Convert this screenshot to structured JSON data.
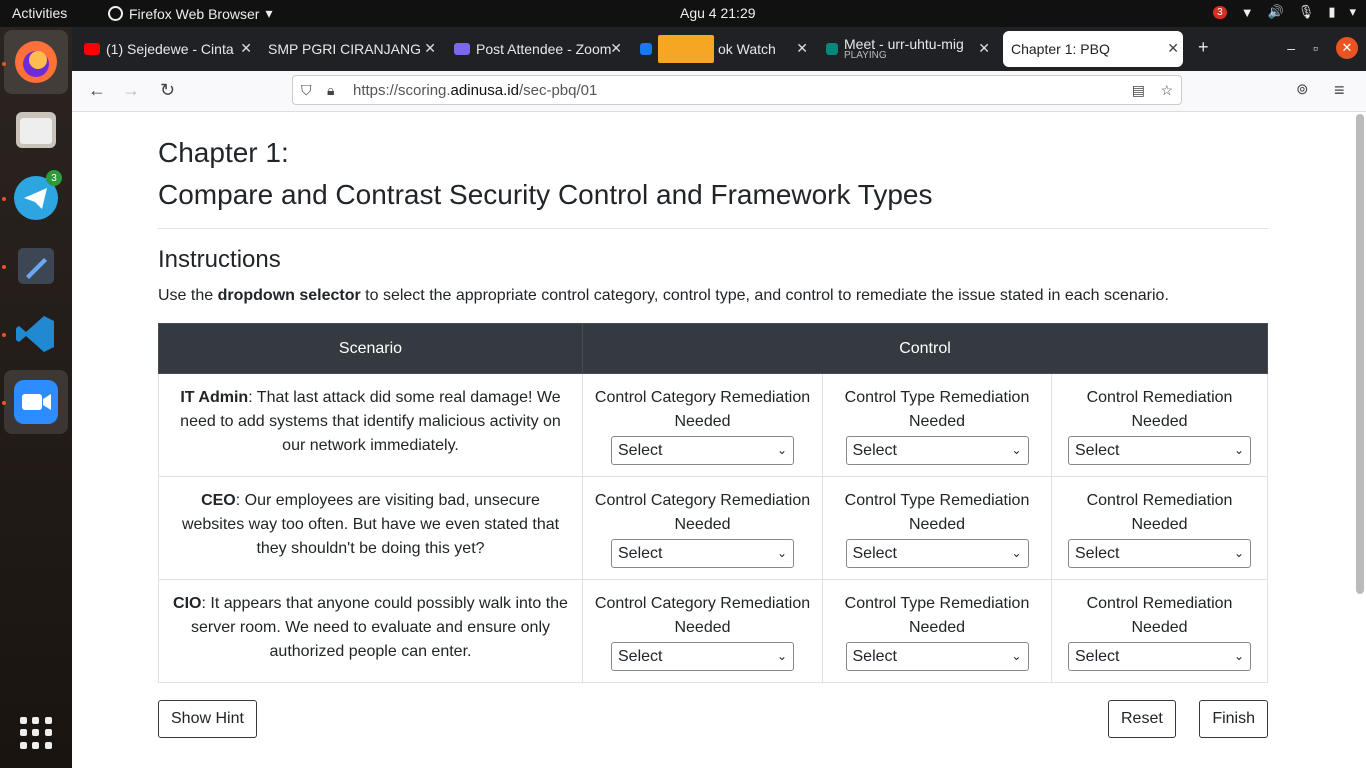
{
  "topbar": {
    "activities": "Activities",
    "app_menu": "Firefox Web Browser",
    "clock": "Agu 4  21:29",
    "notification_count": "3"
  },
  "dock": {
    "telegram_badge": "3"
  },
  "tabs": [
    {
      "title": "(1) Sejedewe - Cinta",
      "icon_color": "#ff0000"
    },
    {
      "title": "SMP PGRI CIRANJANG",
      "icon_color": ""
    },
    {
      "title": "Post Attendee - Zoom",
      "icon_color": "#2d8cff"
    },
    {
      "title": "ok Watch",
      "icon_color": "#1877f2"
    },
    {
      "title": "Meet - urr-uhtu-mig",
      "subtitle": "PLAYING",
      "icon_color": "#00897b"
    },
    {
      "title": "Chapter 1: PBQ",
      "icon_color": ""
    }
  ],
  "url": {
    "prefix": "https://scoring.",
    "host": "adinusa.id",
    "path": "/sec-pbq/01"
  },
  "page": {
    "title_line1": "Chapter 1:",
    "title_line2": "Compare and Contrast Security Control and Framework Types",
    "instructions_heading": "Instructions",
    "instructions_pre": "Use the ",
    "instructions_bold": "dropdown selector",
    "instructions_post": " to select the appropriate control category, control type, and control to remediate the issue stated in each scenario.",
    "table": {
      "header_scenario": "Scenario",
      "header_control": "Control",
      "col_category": "Control Category Remediation Needed",
      "col_type": "Control Type Remediation Needed",
      "col_control": "Control Remediation Needed",
      "select_placeholder": "Select",
      "rows": [
        {
          "role": "IT Admin",
          "text": ": That last attack did some real damage! We need to add systems that identify malicious activity on our network immediately."
        },
        {
          "role": "CEO",
          "text": ": Our employees are visiting bad, unsecure websites way too often. But have we even stated that they shouldn't be doing this yet?"
        },
        {
          "role": "CIO",
          "text": ": It appears that anyone could possibly walk into the server room. We need to evaluate and ensure only authorized people can enter."
        }
      ]
    },
    "buttons": {
      "hint": "Show Hint",
      "reset": "Reset",
      "finish": "Finish"
    }
  }
}
